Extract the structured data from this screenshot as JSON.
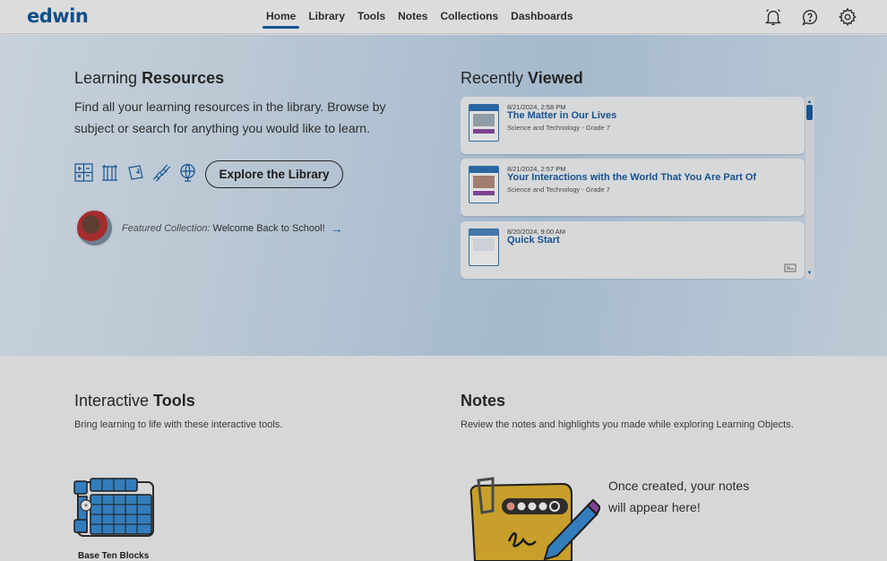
{
  "app": {
    "logo": "edwin"
  },
  "nav": {
    "items": [
      {
        "label": "Home",
        "active": true
      },
      {
        "label": "Library",
        "active": false
      },
      {
        "label": "Tools",
        "active": false
      },
      {
        "label": "Notes",
        "active": false
      },
      {
        "label": "Collections",
        "active": false
      },
      {
        "label": "Dashboards",
        "active": false
      }
    ],
    "icons": [
      "notifications-icon",
      "help-icon",
      "settings-icon"
    ]
  },
  "resources": {
    "title_light": "Learning ",
    "title_bold": "Resources",
    "lead": "Find all your learning resources in the library. Browse by subject or search for anything you would like to learn.",
    "explore_label": "Explore the Library",
    "featured_prefix": "Featured Collection:",
    "featured_name": " Welcome Back to School!"
  },
  "recent": {
    "title_light": "Recently ",
    "title_bold": "Viewed",
    "items": [
      {
        "date": "8/21/2024, 2:58 PM",
        "title": "The Matter in Our Lives",
        "subtitle": "Science and Technology - Grade 7"
      },
      {
        "date": "8/21/2024, 2:57 PM",
        "title": "Your Interactions with the World That You Are Part Of",
        "subtitle": "Science and Technology - Grade 7"
      },
      {
        "date": "8/20/2024, 9:00 AM",
        "title": "Quick Start",
        "subtitle": ""
      }
    ]
  },
  "tools": {
    "title_light": "Interactive ",
    "title_bold": "Tools",
    "subtitle": "Bring learning to life with these interactive tools.",
    "items": [
      {
        "label": "Base Ten Blocks"
      }
    ]
  },
  "notes": {
    "title": "Notes",
    "subtitle": "Review the notes and highlights you made while exploring Learning Objects.",
    "empty_line1": "Once created, your notes",
    "empty_line2": "will appear here!"
  },
  "colors": {
    "brand": "#0f5a9c",
    "link": "#1a5fa6"
  }
}
